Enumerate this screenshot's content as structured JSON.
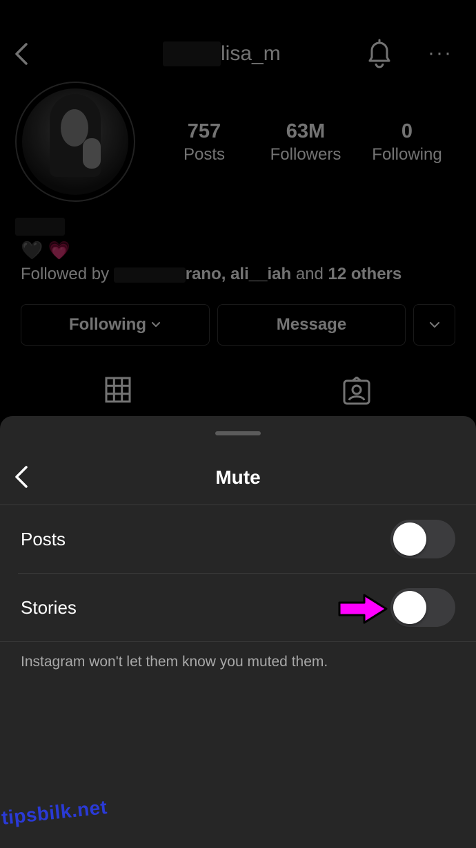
{
  "profile": {
    "username_visible": "lisa_m",
    "stats": [
      {
        "value": "757",
        "label": "Posts"
      },
      {
        "value": "63M",
        "label": "Followers"
      },
      {
        "value": "0",
        "label": "Following"
      }
    ],
    "bio_emojis": [
      "🖤",
      "💗"
    ],
    "followed_by": {
      "prefix": "Followed by",
      "names": "rano, ali__iah",
      "connector": "and",
      "others": "12 others"
    },
    "buttons": {
      "following": "Following",
      "message": "Message"
    }
  },
  "sheet": {
    "title": "Mute",
    "rows": [
      {
        "label": "Posts",
        "on": false
      },
      {
        "label": "Stories",
        "on": false
      }
    ],
    "note": "Instagram won't let them know you muted them."
  },
  "colors": {
    "arrow": "#ff00ff",
    "sheet_bg": "#262626",
    "toggle_off": "#3c3c3e"
  },
  "watermark": "tipsbilk.net"
}
